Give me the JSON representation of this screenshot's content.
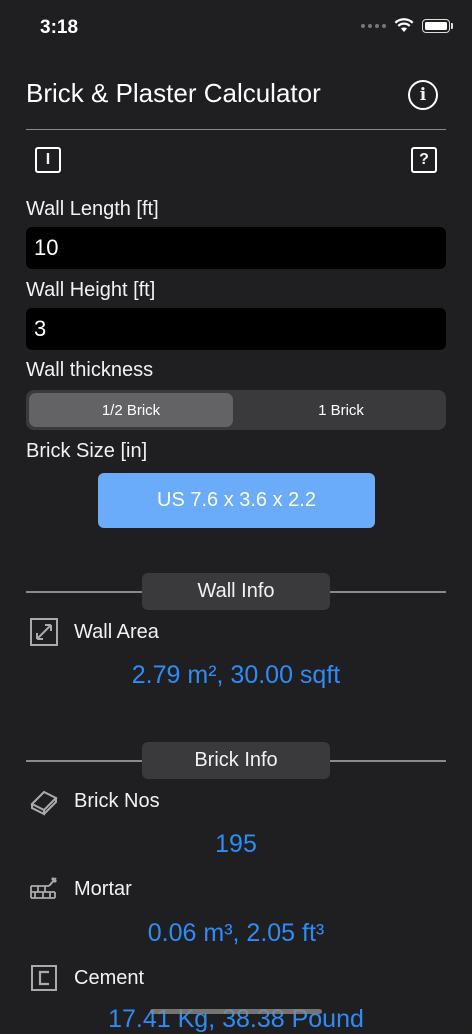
{
  "status_bar": {
    "time": "3:18"
  },
  "header": {
    "title": "Brick & Plaster Calculator"
  },
  "toolbar": {
    "left_icon_glyph": "I",
    "right_icon_glyph": "?"
  },
  "inputs": {
    "length_label": "Wall Length [ft]",
    "length_value": "10",
    "height_label": "Wall Height [ft]",
    "height_value": "3"
  },
  "thickness": {
    "label": "Wall thickness",
    "options": [
      "1/2 Brick",
      "1 Brick"
    ],
    "selected": "1/2 Brick"
  },
  "brick_size": {
    "label": "Brick Size [in]",
    "button": "US 7.6 x 3.6 x 2.2"
  },
  "wall_info": {
    "title": "Wall Info",
    "area_label": "Wall Area",
    "area_value": "2.79 m², 30.00 sqft"
  },
  "brick_info": {
    "title": "Brick Info",
    "nos_label": "Brick Nos",
    "nos_value": "195",
    "mortar_label": "Mortar",
    "mortar_value": "0.06 m³, 2.05 ft³",
    "cement_label": "Cement",
    "cement_value": "17.41 Kg, 38.38 Pound"
  },
  "colors": {
    "accent": "#2e8cf6",
    "button": "#6aacf9",
    "background": "#1f1f21"
  }
}
